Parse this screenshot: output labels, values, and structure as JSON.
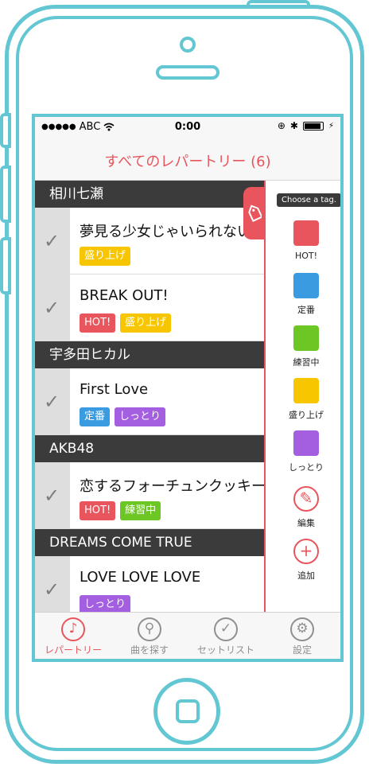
{
  "statusbar": {
    "signal": "●●●●●",
    "carrier": "ABC",
    "time": "0:00"
  },
  "nav": {
    "title": "すべてのレパートリー (6)"
  },
  "colors": {
    "accent": "#e9555c",
    "frame": "#63c7d3",
    "hot": "#e9555c",
    "standard": "#3a9be0",
    "practicing": "#6cc623",
    "exciting": "#f7c600",
    "calm": "#a35fe0"
  },
  "sections": [
    {
      "artist": "相川七瀬",
      "songs": [
        {
          "title": "夢見る少女じゃいられない",
          "tags": [
            "盛り上げ"
          ]
        },
        {
          "title": "BREAK OUT!",
          "tags": [
            "HOT!",
            "盛り上げ"
          ]
        }
      ]
    },
    {
      "artist": "宇多田ヒカル",
      "songs": [
        {
          "title": "First Love",
          "tags": [
            "定番",
            "しっとり"
          ]
        }
      ]
    },
    {
      "artist": "AKB48",
      "songs": [
        {
          "title": "恋するフォーチュンクッキー",
          "tags": [
            "HOT!",
            "練習中"
          ]
        }
      ]
    },
    {
      "artist": "DREAMS COME TRUE",
      "songs": [
        {
          "title": "LOVE LOVE LOVE",
          "tags": [
            "しっとり"
          ]
        }
      ]
    }
  ],
  "drawer": {
    "hint": "Choose a tag.",
    "tags": [
      "HOT!",
      "定番",
      "練習中",
      "盛り上げ",
      "しっとり"
    ],
    "edit_label": "編集",
    "add_label": "追加"
  },
  "tabbar": {
    "items": [
      {
        "label": "レパートリー",
        "icon": "music-note-icon"
      },
      {
        "label": "曲を探す",
        "icon": "search-icon"
      },
      {
        "label": "セットリスト",
        "icon": "check-icon"
      },
      {
        "label": "設定",
        "icon": "gear-icon"
      }
    ]
  }
}
